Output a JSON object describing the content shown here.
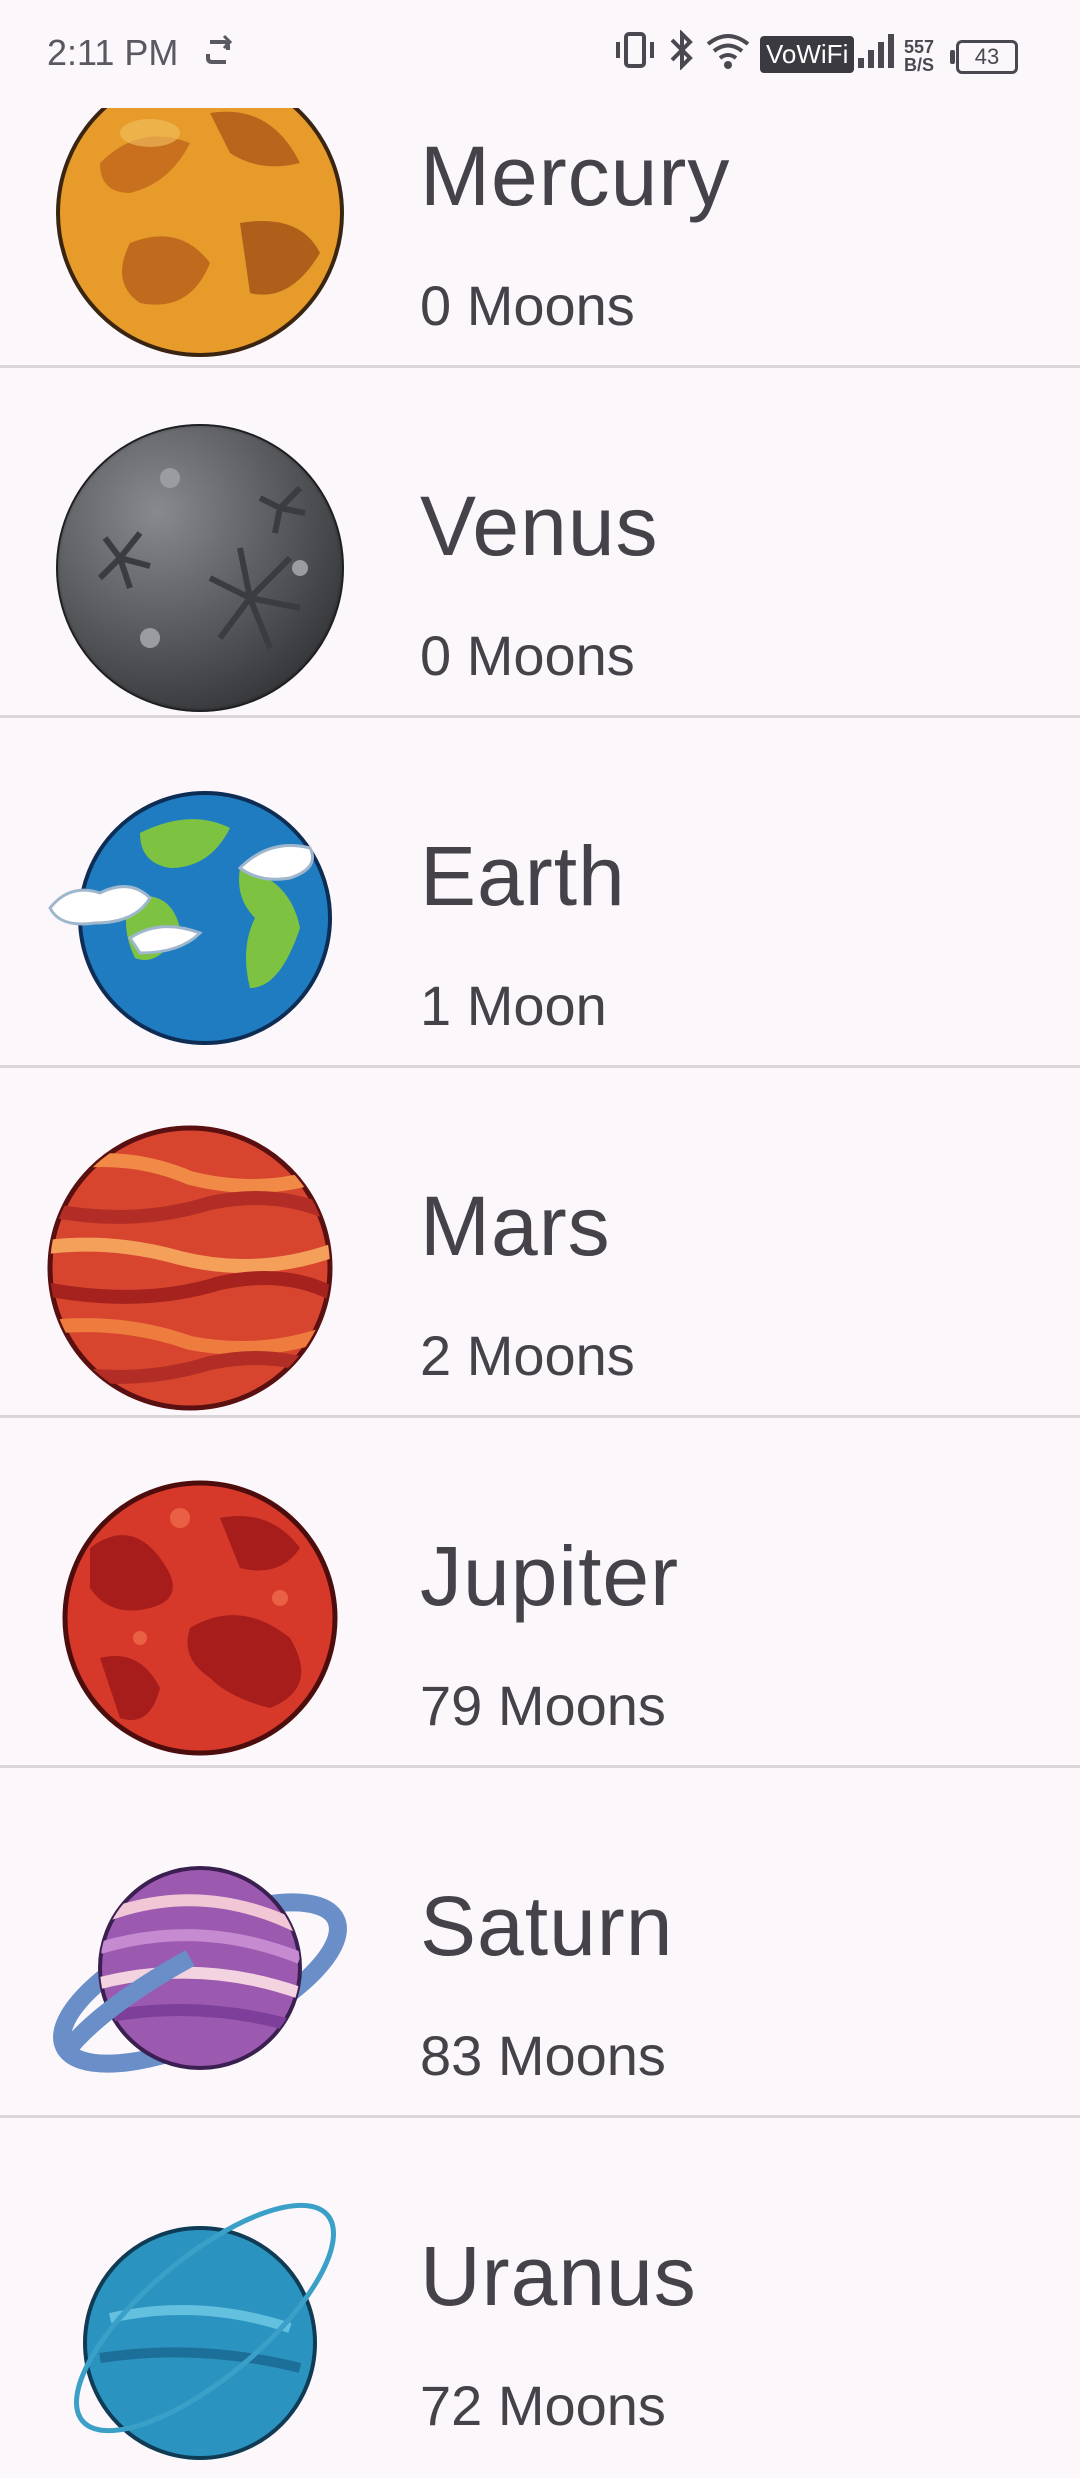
{
  "status_bar": {
    "time": "2:11 PM",
    "vowifi": "VoWiFi",
    "speed_top": "557",
    "speed_bottom": "B/S",
    "battery": "43"
  },
  "planets": [
    {
      "name": "Mercury",
      "moons": "0 Moons",
      "icon": "mercury-icon"
    },
    {
      "name": "Venus",
      "moons": "0 Moons",
      "icon": "venus-icon"
    },
    {
      "name": "Earth",
      "moons": "1 Moon",
      "icon": "earth-icon"
    },
    {
      "name": "Mars",
      "moons": "2 Moons",
      "icon": "mars-icon"
    },
    {
      "name": "Jupiter",
      "moons": "79 Moons",
      "icon": "jupiter-icon"
    },
    {
      "name": "Saturn",
      "moons": "83 Moons",
      "icon": "saturn-icon"
    },
    {
      "name": "Uranus",
      "moons": "72 Moons",
      "icon": "uranus-icon"
    }
  ]
}
